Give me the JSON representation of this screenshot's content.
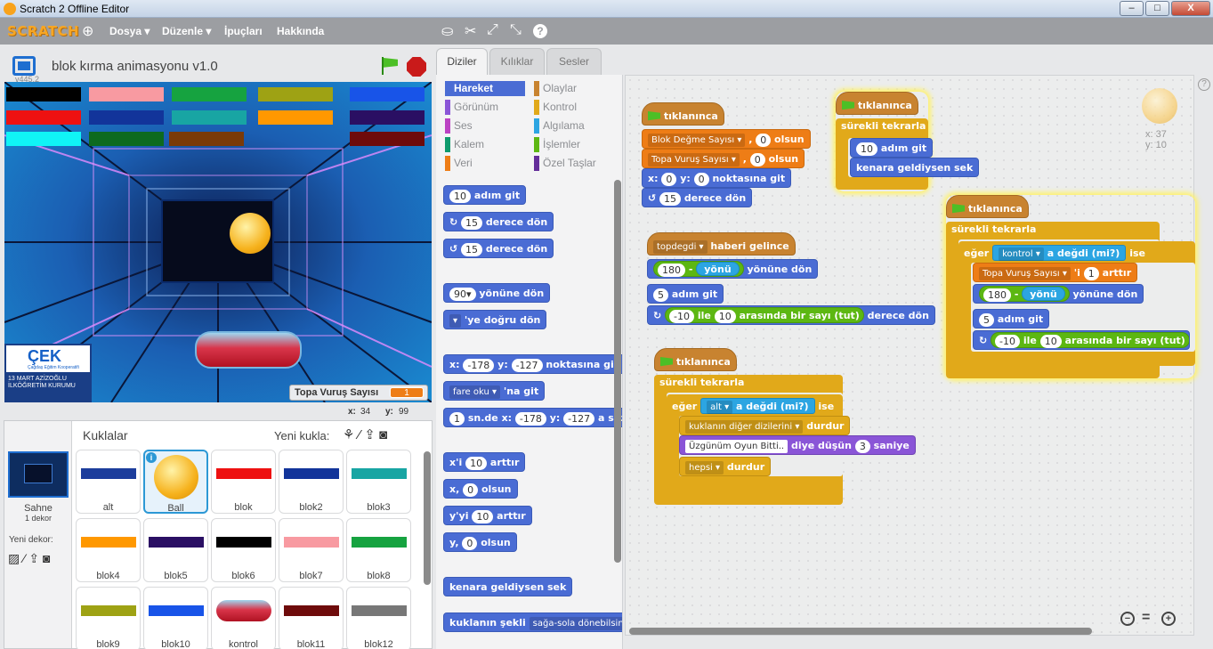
{
  "window": {
    "title": "Scratch 2 Offline Editor",
    "min": "–",
    "max": "□",
    "close": "X"
  },
  "menu": {
    "logo": "SCRATCH",
    "file": "Dosya ▾",
    "edit": "Düzenle ▾",
    "tips": "İpuçları",
    "about": "Hakkında"
  },
  "stage": {
    "title": "blok kırma animasyonu v1.0",
    "version": "v445.2",
    "var_label": "Topa Vuruş Sayısı",
    "var_value": "1",
    "x_label": "x:",
    "x": "34",
    "y_label": "y:",
    "y": "99",
    "logo": "ÇEK",
    "logo_sub": "Çağdaş Eğitim Kooperatifi",
    "school": "13 MART AZİZOĞLU İLKÖĞRETİM KURUMU"
  },
  "tabs": [
    "Diziler",
    "Kılıklar",
    "Sesler"
  ],
  "categories": {
    "left": [
      "Hareket",
      "Görünüm",
      "Ses",
      "Kalem",
      "Veri"
    ],
    "right": [
      "Olaylar",
      "Kontrol",
      "Algılama",
      "İşlemler",
      "Özel Taşlar"
    ]
  },
  "palette": {
    "move": "adım git",
    "move_n": "10",
    "turn_r": "derece dön",
    "turn_n": "15",
    "turn_l": "derece dön",
    "point_dir": "yönüne dön",
    "dir_n": "90▾",
    "point_to": "'ye doğru dön",
    "goto_xy_x": "x:",
    "goto_xy": "noktasına git",
    "gx": "-178",
    "gy_l": "y:",
    "gy": "-127",
    "goto": "fare oku ▾",
    "goto_t": "'na git",
    "glide_n": "1",
    "glide_t": "sn.de x:",
    "glide_x": "-178",
    "glide_y_l": "y:",
    "glide_y": "-127",
    "glide_end": "a süz",
    "chx": "x'i",
    "chx_n": "10",
    "chx_t": "arttır",
    "setx": "x,",
    "setx_n": "0",
    "setx_t": "olsun",
    "chy": "y'yi",
    "chy_n": "10",
    "chy_t": "arttır",
    "sety": "y,",
    "sety_n": "0",
    "sety_t": "olsun",
    "bounce": "kenara geldiysen sek",
    "rot": "kuklanın şekli",
    "rot_dd": "sağa-sola dönebilsin"
  },
  "sprites": {
    "header": "Kuklalar",
    "new": "Yeni kukla:",
    "stage_name": "Sahne",
    "stage_sub": "1 dekor",
    "new_backdrop": "Yeni dekor:",
    "items": [
      {
        "name": "alt",
        "color": "#1c3d9c"
      },
      {
        "name": "Ball",
        "color": "#f6b21d"
      },
      {
        "name": "blok",
        "color": "#ee1111"
      },
      {
        "name": "blok2",
        "color": "#12349a"
      },
      {
        "name": "blok3",
        "color": "#18a5a3"
      },
      {
        "name": "blok4",
        "color": "#ff9800"
      },
      {
        "name": "blok5",
        "color": "#2a0f63"
      },
      {
        "name": "blok6",
        "color": "#000000"
      },
      {
        "name": "blok7",
        "color": "#f89aa1"
      },
      {
        "name": "blok8",
        "color": "#16a340"
      },
      {
        "name": "blok9",
        "color": "#9ea214"
      },
      {
        "name": "blok10",
        "color": "#1854e8"
      },
      {
        "name": "kontrol",
        "color": "#d9354a"
      },
      {
        "name": "blok11",
        "color": "#6e0b0b"
      },
      {
        "name": "blok12",
        "color": "#777777"
      }
    ]
  },
  "scripts": {
    "s1": {
      "hat": "tıklanınca",
      "set1": "Blok Değme Sayısı ▾",
      "set1_v": "0",
      "set2": "Topa Vuruş Sayısı ▾",
      "set2_v": "0",
      "olsun": "olsun",
      "goto_x": "0",
      "goto_y": "0",
      "goto_t": "noktasına git",
      "turn": "15",
      "turn_t": "derece dön",
      "x": "x:",
      "y": "y:"
    },
    "s2": {
      "hat": "tıklanınca",
      "forever": "sürekli tekrarla",
      "move": "10",
      "move_t": "adım git",
      "bounce": "kenara geldiysen sek"
    },
    "s3": {
      "hat_dd": "topdegdi ▾",
      "hat_t": "haberi gelince",
      "dir_a": "180",
      "minus": "-",
      "dir_b": "yönü",
      "dir_t": "yönüne dön",
      "move": "5",
      "move_t": "adım git",
      "r1": "-10",
      "r_ile": "ile",
      "r2": "10",
      "r_t": "arasında bir sayı (tut)",
      "r_end": "derece dön"
    },
    "s4": {
      "hat": "tıklanınca",
      "forever": "sürekli tekrarla",
      "if": "eğer",
      "touch_dd": "kontrol ▾",
      "touch_t": "a değdi (mi?)",
      "ise": "ise",
      "chg": "Topa Vuruş Sayısı ▾",
      "chg_t": "'i",
      "chg_n": "1",
      "chg_e": "arttır",
      "dir_a": "180",
      "minus": "-",
      "dir_b": "yönü",
      "dir_t": "yönüne dön",
      "move": "5",
      "move_t": "adım git",
      "r1": "-10",
      "r_ile": "ile",
      "r2": "10",
      "r_t": "arasında bir sayı (tut)"
    },
    "s5": {
      "hat": "tıklanınca",
      "forever": "sürekli tekrarla",
      "if": "eğer",
      "touch_dd": "alt ▾",
      "touch_t": "a değdi (mi?)",
      "ise": "ise",
      "stop1_dd": "kuklanın diğer dizilerini ▾",
      "stop": "durdur",
      "say": "Üzgünüm Oyun Bitti..",
      "say_t": "diye düşün",
      "say_n": "3",
      "say_e": "saniye",
      "stop2_dd": "hepsi ▾"
    }
  },
  "coords": {
    "x_label": "x:",
    "x": "37",
    "y_label": "y:",
    "y": "10"
  },
  "zoom": {
    "out": "−",
    "reset": "=",
    "in": "+"
  }
}
